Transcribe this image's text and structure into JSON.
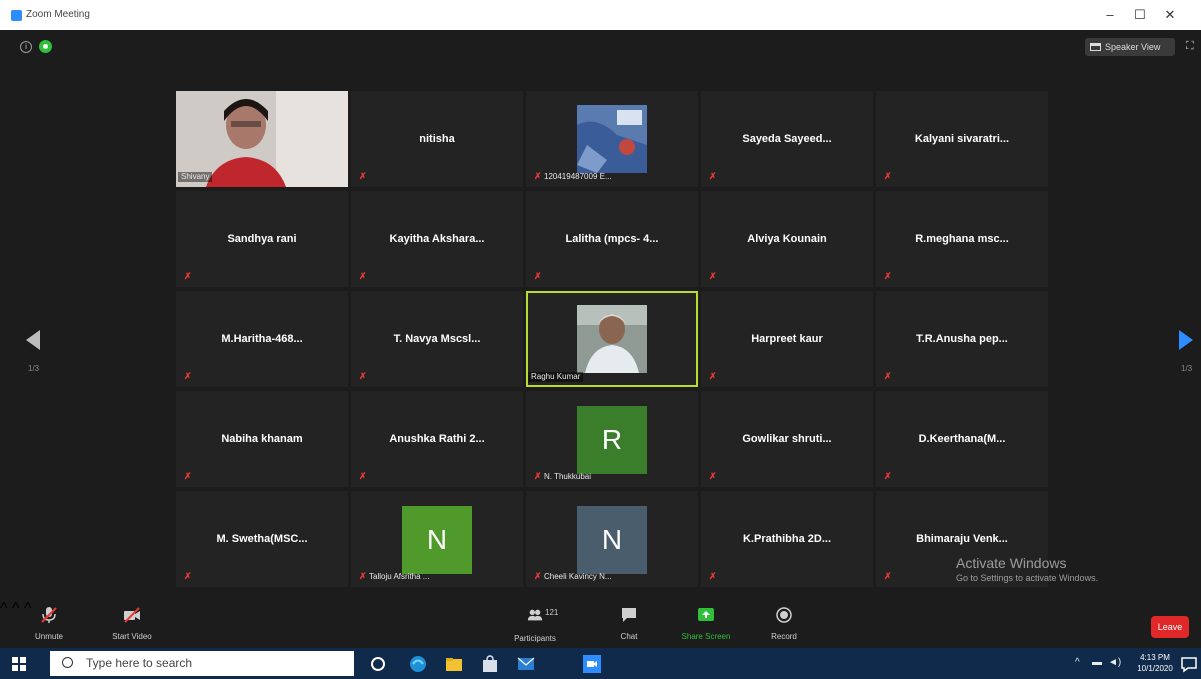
{
  "window": {
    "title": "Zoom Meeting",
    "controls": [
      "–",
      "☐",
      "✕"
    ]
  },
  "topbar": {
    "speaker_view_label": "Speaker View"
  },
  "gallery": {
    "page_indicator_left": "1/3",
    "page_indicator_right": "1/3",
    "tiles": [
      {
        "name": "",
        "label": "Shivany",
        "type": "video",
        "muted": false
      },
      {
        "name": "nitisha",
        "label": "",
        "type": "name",
        "muted": true
      },
      {
        "name": "",
        "label": "120419487009 E...",
        "type": "photo",
        "muted": true
      },
      {
        "name": "Sayeda Sayeed...",
        "label": "",
        "type": "name",
        "muted": true
      },
      {
        "name": "Kalyani sivaratri...",
        "label": "",
        "type": "name",
        "muted": true
      },
      {
        "name": "Sandhya rani",
        "label": "",
        "type": "name",
        "muted": true
      },
      {
        "name": "Kayitha Akshara...",
        "label": "",
        "type": "name",
        "muted": true
      },
      {
        "name": "Lalitha (mpcs- 4...",
        "label": "",
        "type": "name",
        "muted": true
      },
      {
        "name": "Alviya Kounain",
        "label": "",
        "type": "name",
        "muted": true
      },
      {
        "name": "R.meghana msc...",
        "label": "",
        "type": "name",
        "muted": true
      },
      {
        "name": "M.Haritha-468...",
        "label": "",
        "type": "name",
        "muted": true
      },
      {
        "name": "T. Navya Mscsl...",
        "label": "",
        "type": "name",
        "muted": true
      },
      {
        "name": "",
        "label": "Raghu Kumar",
        "type": "video-active",
        "muted": false
      },
      {
        "name": "Harpreet kaur",
        "label": "",
        "type": "name",
        "muted": true
      },
      {
        "name": "T.R.Anusha pep...",
        "label": "",
        "type": "name",
        "muted": true
      },
      {
        "name": "Nabiha khanam",
        "label": "",
        "type": "name",
        "muted": true
      },
      {
        "name": "Anushka Rathi 2...",
        "label": "",
        "type": "name",
        "muted": true
      },
      {
        "name": "R",
        "label": "N. Thukkubai",
        "type": "avatar",
        "avatar_color": "#3a7d2a",
        "muted": true
      },
      {
        "name": "Gowlikar shruti...",
        "label": "",
        "type": "name",
        "muted": true
      },
      {
        "name": "D.Keerthana(M...",
        "label": "",
        "type": "name",
        "muted": true
      },
      {
        "name": "M. Swetha(MSC...",
        "label": "",
        "type": "name",
        "muted": true
      },
      {
        "name": "N",
        "label": "Talloju Afsritha ...",
        "type": "avatar",
        "avatar_color": "#4f9a2b",
        "muted": true
      },
      {
        "name": "N",
        "label": "Cheeli Kavincy N...",
        "type": "avatar",
        "avatar_color": "#4a5d6d",
        "muted": true
      },
      {
        "name": "K.Prathibha 2D...",
        "label": "",
        "type": "name",
        "muted": true
      },
      {
        "name": "Bhimaraju Venk...",
        "label": "",
        "type": "name",
        "muted": true
      }
    ]
  },
  "watermark": {
    "line1": "Activate Windows",
    "line2": "Go to Settings to activate Windows."
  },
  "controls": {
    "unmute": "Unmute",
    "start_video": "Start Video",
    "participants": "Participants",
    "participants_count": "121",
    "chat": "Chat",
    "share_screen": "Share Screen",
    "record": "Record",
    "leave": "Leave"
  },
  "taskbar": {
    "search_placeholder": "Type here to search",
    "time": "4:13 PM",
    "date": "10/1/2020"
  },
  "colors": {
    "active_speaker": "#b5dc2e",
    "share_screen": "#2fbf3b",
    "leave": "#e02828",
    "muted": "#e53935"
  }
}
